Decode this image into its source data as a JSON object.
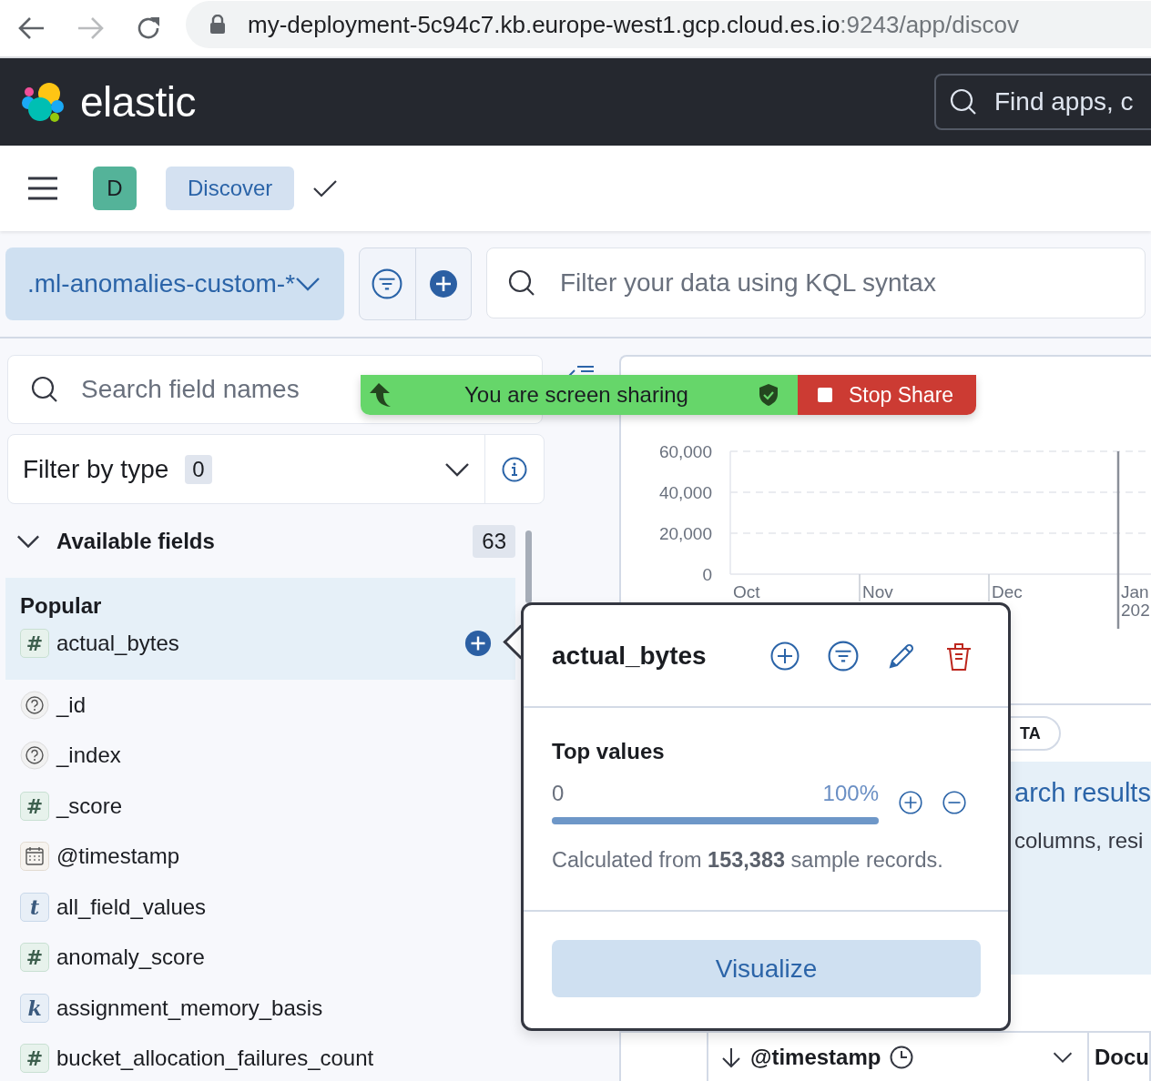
{
  "browser": {
    "url_host": "my-deployment-5c94c7.kb.europe-west1.gcp.cloud.es.io",
    "url_rest": ":9243/app/discov"
  },
  "header": {
    "brand": "elastic",
    "search": {
      "placeholder": "Find apps, c"
    }
  },
  "breadcrumbs": {
    "space_initial": "D",
    "items": [
      {
        "label": "Discover",
        "selected": true
      }
    ]
  },
  "query_bar": {
    "index_pattern": ".ml-anomalies-custom-*",
    "query": {
      "placeholder": "Filter your data using KQL syntax"
    }
  },
  "sidebar": {
    "search": {
      "placeholder": "Search field names"
    },
    "filter": {
      "label": "Filter by type",
      "count": "0"
    },
    "available": {
      "title": "Available fields",
      "count": "63",
      "expanded": true
    },
    "popular": {
      "title": "Popular",
      "fields": [
        {
          "name": "actual_bytes",
          "kind": "number",
          "glyph": "#",
          "selected": true
        }
      ]
    },
    "fields": [
      {
        "name": "_id",
        "kind": "unknown",
        "selected": false
      },
      {
        "name": "_index",
        "kind": "unknown",
        "selected": false
      },
      {
        "name": "_score",
        "kind": "number",
        "glyph": "#",
        "selected": false
      },
      {
        "name": "@timestamp",
        "kind": "date",
        "selected": false
      },
      {
        "name": "all_field_values",
        "kind": "text",
        "glyph": "t",
        "selected": false
      },
      {
        "name": "anomaly_score",
        "kind": "number",
        "glyph": "#",
        "selected": false
      },
      {
        "name": "assignment_memory_basis",
        "kind": "keyword",
        "glyph": "k",
        "selected": false
      },
      {
        "name": "bucket_allocation_failures_count",
        "kind": "number",
        "glyph": "#",
        "selected": false
      }
    ]
  },
  "main": {
    "chart": {
      "chart_data": {
        "type": "bar",
        "categories": [
          "Oct",
          "Nov",
          "Dec",
          "Jan 202"
        ],
        "ylim": [
          0,
          60000
        ],
        "yticks": [
          {
            "value": 0,
            "label": "0"
          },
          {
            "value": 20000,
            "label": "20,000"
          },
          {
            "value": 40000,
            "label": "40,000"
          },
          {
            "value": 60000,
            "label": "60,000"
          }
        ],
        "values": [
          null,
          null,
          null,
          null
        ],
        "ref_lines": [
          {
            "axis": "x",
            "value": "Jan 202"
          }
        ]
      }
    },
    "tab": {
      "label": "TA"
    },
    "callout": {
      "title": "arch results",
      "text": "columns, resi"
    },
    "table": {
      "columns": [
        {
          "label": "@timestamp",
          "kind": "date",
          "sort_descending": true
        },
        {
          "label": "Docu",
          "kind": "text",
          "sort_descending": false
        }
      ]
    }
  },
  "popover": {
    "title": "actual_bytes",
    "section_title": "Top values",
    "values": [
      {
        "label": "0",
        "percent": "100%",
        "level": 1
      }
    ],
    "note": "Calculated from **153,383** sample records.",
    "button": "Visualize"
  },
  "screen_share": {
    "message": "You are screen sharing",
    "stop": "Stop Share"
  }
}
